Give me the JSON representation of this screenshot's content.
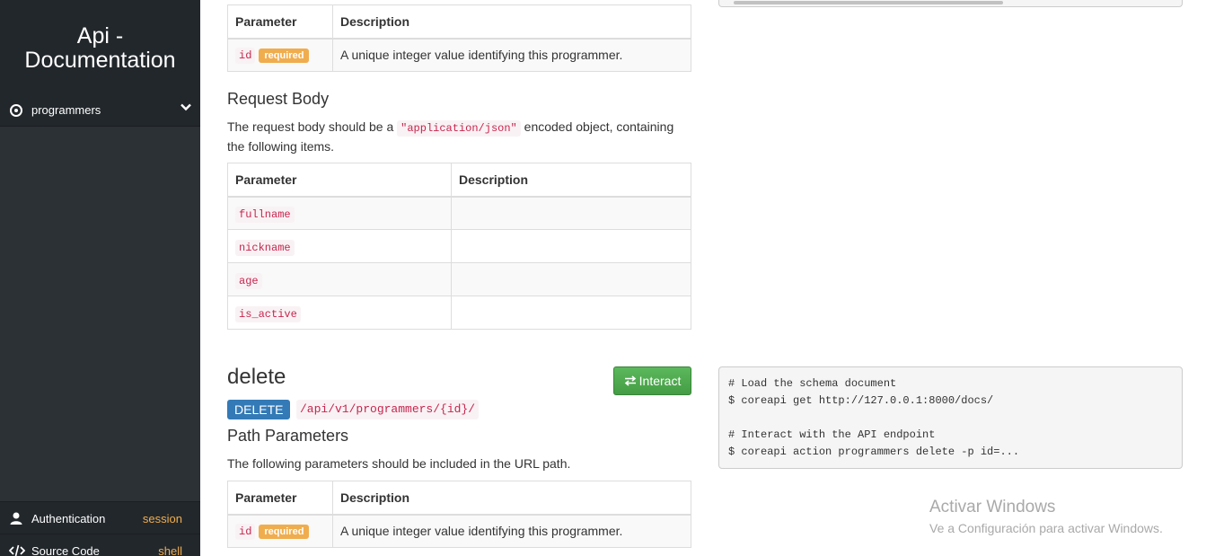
{
  "sidebar": {
    "brand_line1": "Api -",
    "brand_line2": "Documentation",
    "nav_item_label": "programmers",
    "auth_label": "Authentication",
    "auth_value": "session",
    "source_label": "Source Code",
    "source_value": "shell"
  },
  "top_table": {
    "headers": [
      "Parameter",
      "Description"
    ],
    "row_param": "id",
    "row_badge": "required",
    "row_desc": "A unique integer value identifying this programmer."
  },
  "request_body": {
    "heading": "Request Body",
    "desc_before": "The request body should be a ",
    "desc_code": "\"application/json\"",
    "desc_after": " encoded object, containing the following items.",
    "headers": [
      "Parameter",
      "Description"
    ],
    "rows": [
      "fullname",
      "nickname",
      "age",
      "is_active"
    ]
  },
  "delete_section": {
    "title": "delete",
    "interact_label": "Interact",
    "method": "DELETE",
    "path": "/api/v1/programmers/{id}/",
    "path_params_heading": "Path Parameters",
    "path_params_desc": "The following parameters should be included in the URL path.",
    "headers": [
      "Parameter",
      "Description"
    ],
    "row_param": "id",
    "row_badge": "required",
    "row_desc": "A unique integer value identifying this programmer."
  },
  "code_sample": {
    "line1": "# Load the schema document",
    "line2": "$ coreapi get http://127.0.0.1:8000/docs/",
    "line3": "",
    "line4": "# Interact with the API endpoint",
    "line5": "$ coreapi action programmers delete -p id=..."
  },
  "watermark": {
    "title": "Activar Windows",
    "subtitle": "Ve a Configuración para activar Windows."
  }
}
